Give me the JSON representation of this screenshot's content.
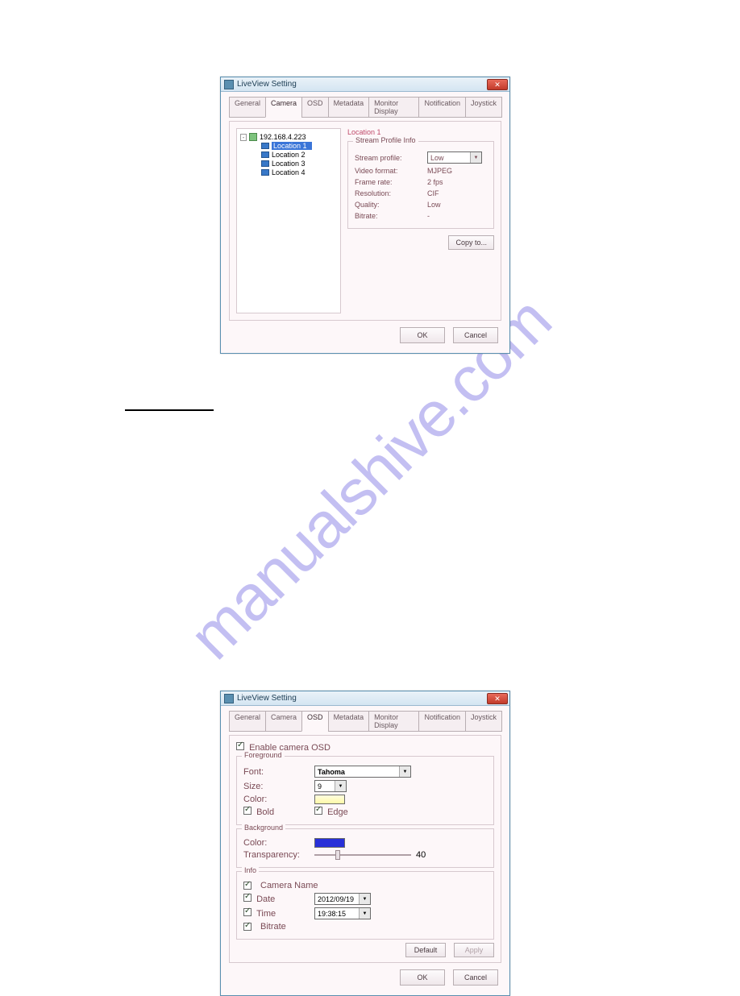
{
  "watermark": "manualshive.com",
  "tabs": [
    "General",
    "Camera",
    "OSD",
    "Metadata",
    "Monitor Display",
    "Notification",
    "Joystick"
  ],
  "footer": {
    "ok": "OK",
    "cancel": "Cancel"
  },
  "dialog1": {
    "title": "LiveView Setting",
    "tree": {
      "root": "192.168.4.223",
      "children": [
        "Location 1",
        "Location 2",
        "Location 3",
        "Location 4"
      ]
    },
    "right": {
      "heading": "Location 1",
      "group_title": "Stream Profile Info",
      "rows": [
        {
          "label": "Stream profile:",
          "value": "Low"
        },
        {
          "label": "Video format:",
          "value": "MJPEG"
        },
        {
          "label": "Frame rate:",
          "value": "2 fps"
        },
        {
          "label": "Resolution:",
          "value": "CIF"
        },
        {
          "label": "Quality:",
          "value": "Low"
        },
        {
          "label": "Bitrate:",
          "value": "-"
        }
      ],
      "copy_btn": "Copy to..."
    }
  },
  "dialog2": {
    "title": "LiveView Setting",
    "enable_label": "Enable camera OSD",
    "fg": {
      "title": "Foreground",
      "font_label": "Font:",
      "font_value": "Tahoma",
      "size_label": "Size:",
      "size_value": "9",
      "color_label": "Color:",
      "fg_color": "#fff9a8",
      "bold_label": "Bold",
      "edge_label": "Edge"
    },
    "bg": {
      "title": "Background",
      "color_label": "Color:",
      "bg_color": "#2830d8",
      "transparency_label": "Transparency:",
      "transparency_value": "40"
    },
    "info": {
      "title": "Info",
      "camera_name": "Camera Name",
      "date_label": "Date",
      "date_value": "2012/09/19",
      "time_label": "Time",
      "time_value": "19:38:15",
      "bitrate_label": "Bitrate"
    },
    "default_btn": "Default",
    "apply_btn": "Apply"
  }
}
